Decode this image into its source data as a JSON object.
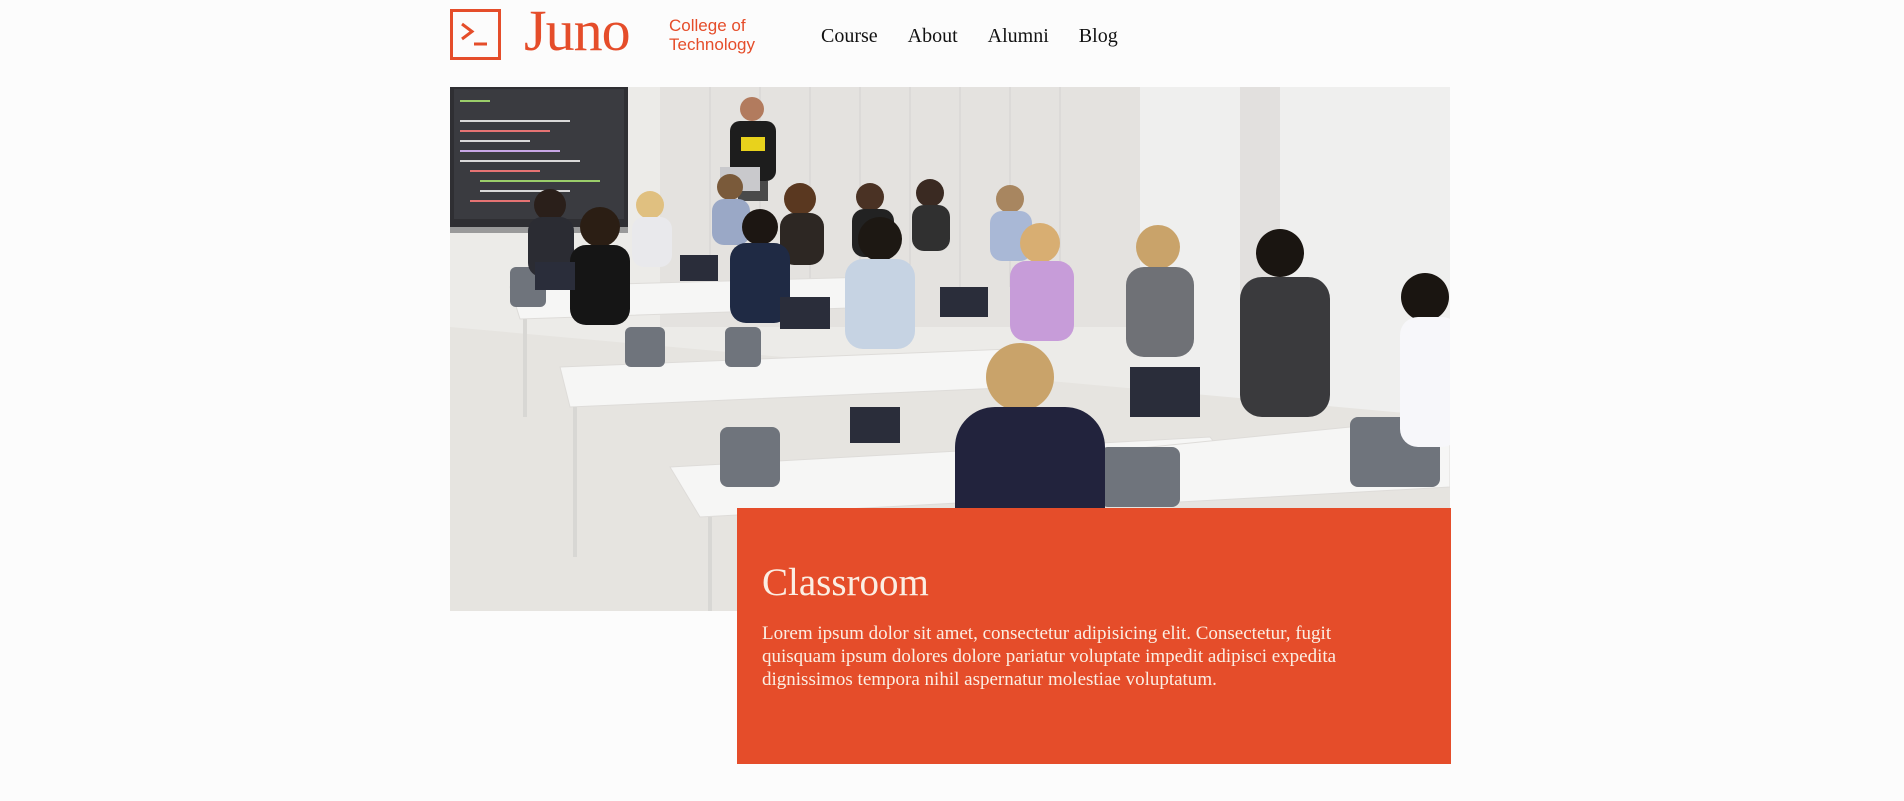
{
  "brand": {
    "name": "Juno",
    "tagline_line1": "College of",
    "tagline_line2": "Technology",
    "accent_color": "#e54d2a",
    "logo_icon": "terminal-prompt-icon"
  },
  "nav": {
    "items": [
      {
        "label": "Course"
      },
      {
        "label": "About"
      },
      {
        "label": "Alumni"
      },
      {
        "label": "Blog"
      }
    ]
  },
  "hero": {
    "image_alt": "Students coding on laptops in a classroom while an instructor presents"
  },
  "card": {
    "title": "Classroom",
    "body": "Lorem ipsum dolor sit amet, consectetur adipisicing elit. Consectetur, fugit quisquam ipsum dolores dolore pariatur voluptate impedit adipisci expedita dignissimos tempora nihil aspernatur molestiae voluptatum."
  }
}
